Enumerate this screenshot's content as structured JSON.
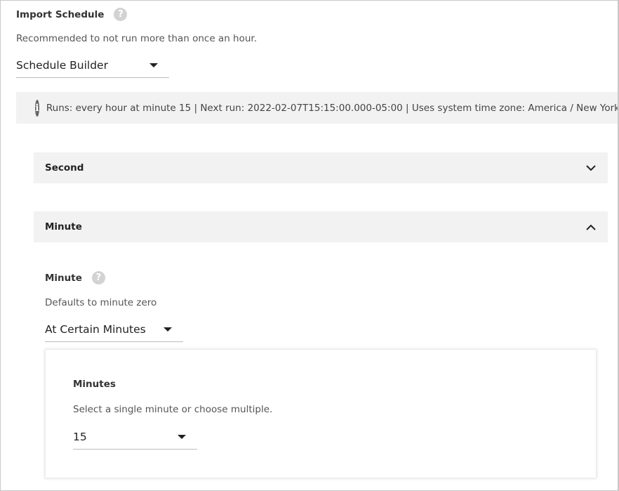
{
  "import_schedule": {
    "title": "Import Schedule",
    "help_glyph": "?",
    "description": "Recommended to not run more than once an hour.",
    "mode_selected": "Schedule Builder"
  },
  "info_bar": {
    "icon": "info-icon",
    "glyph": "i",
    "text": "Runs: every hour at minute 15 | Next run: 2022-02-07T15:15:00.000-05:00 | Uses system time zone: America / New York"
  },
  "sections": {
    "second": {
      "label": "Second",
      "expanded": false
    },
    "minute": {
      "label": "Minute",
      "expanded": true
    }
  },
  "minute_field": {
    "label": "Minute",
    "help_glyph": "?",
    "description": "Defaults to minute zero",
    "mode_selected": "At Certain Minutes"
  },
  "minutes_card": {
    "label": "Minutes",
    "description": "Select a single minute or choose multiple.",
    "selected": "15"
  }
}
